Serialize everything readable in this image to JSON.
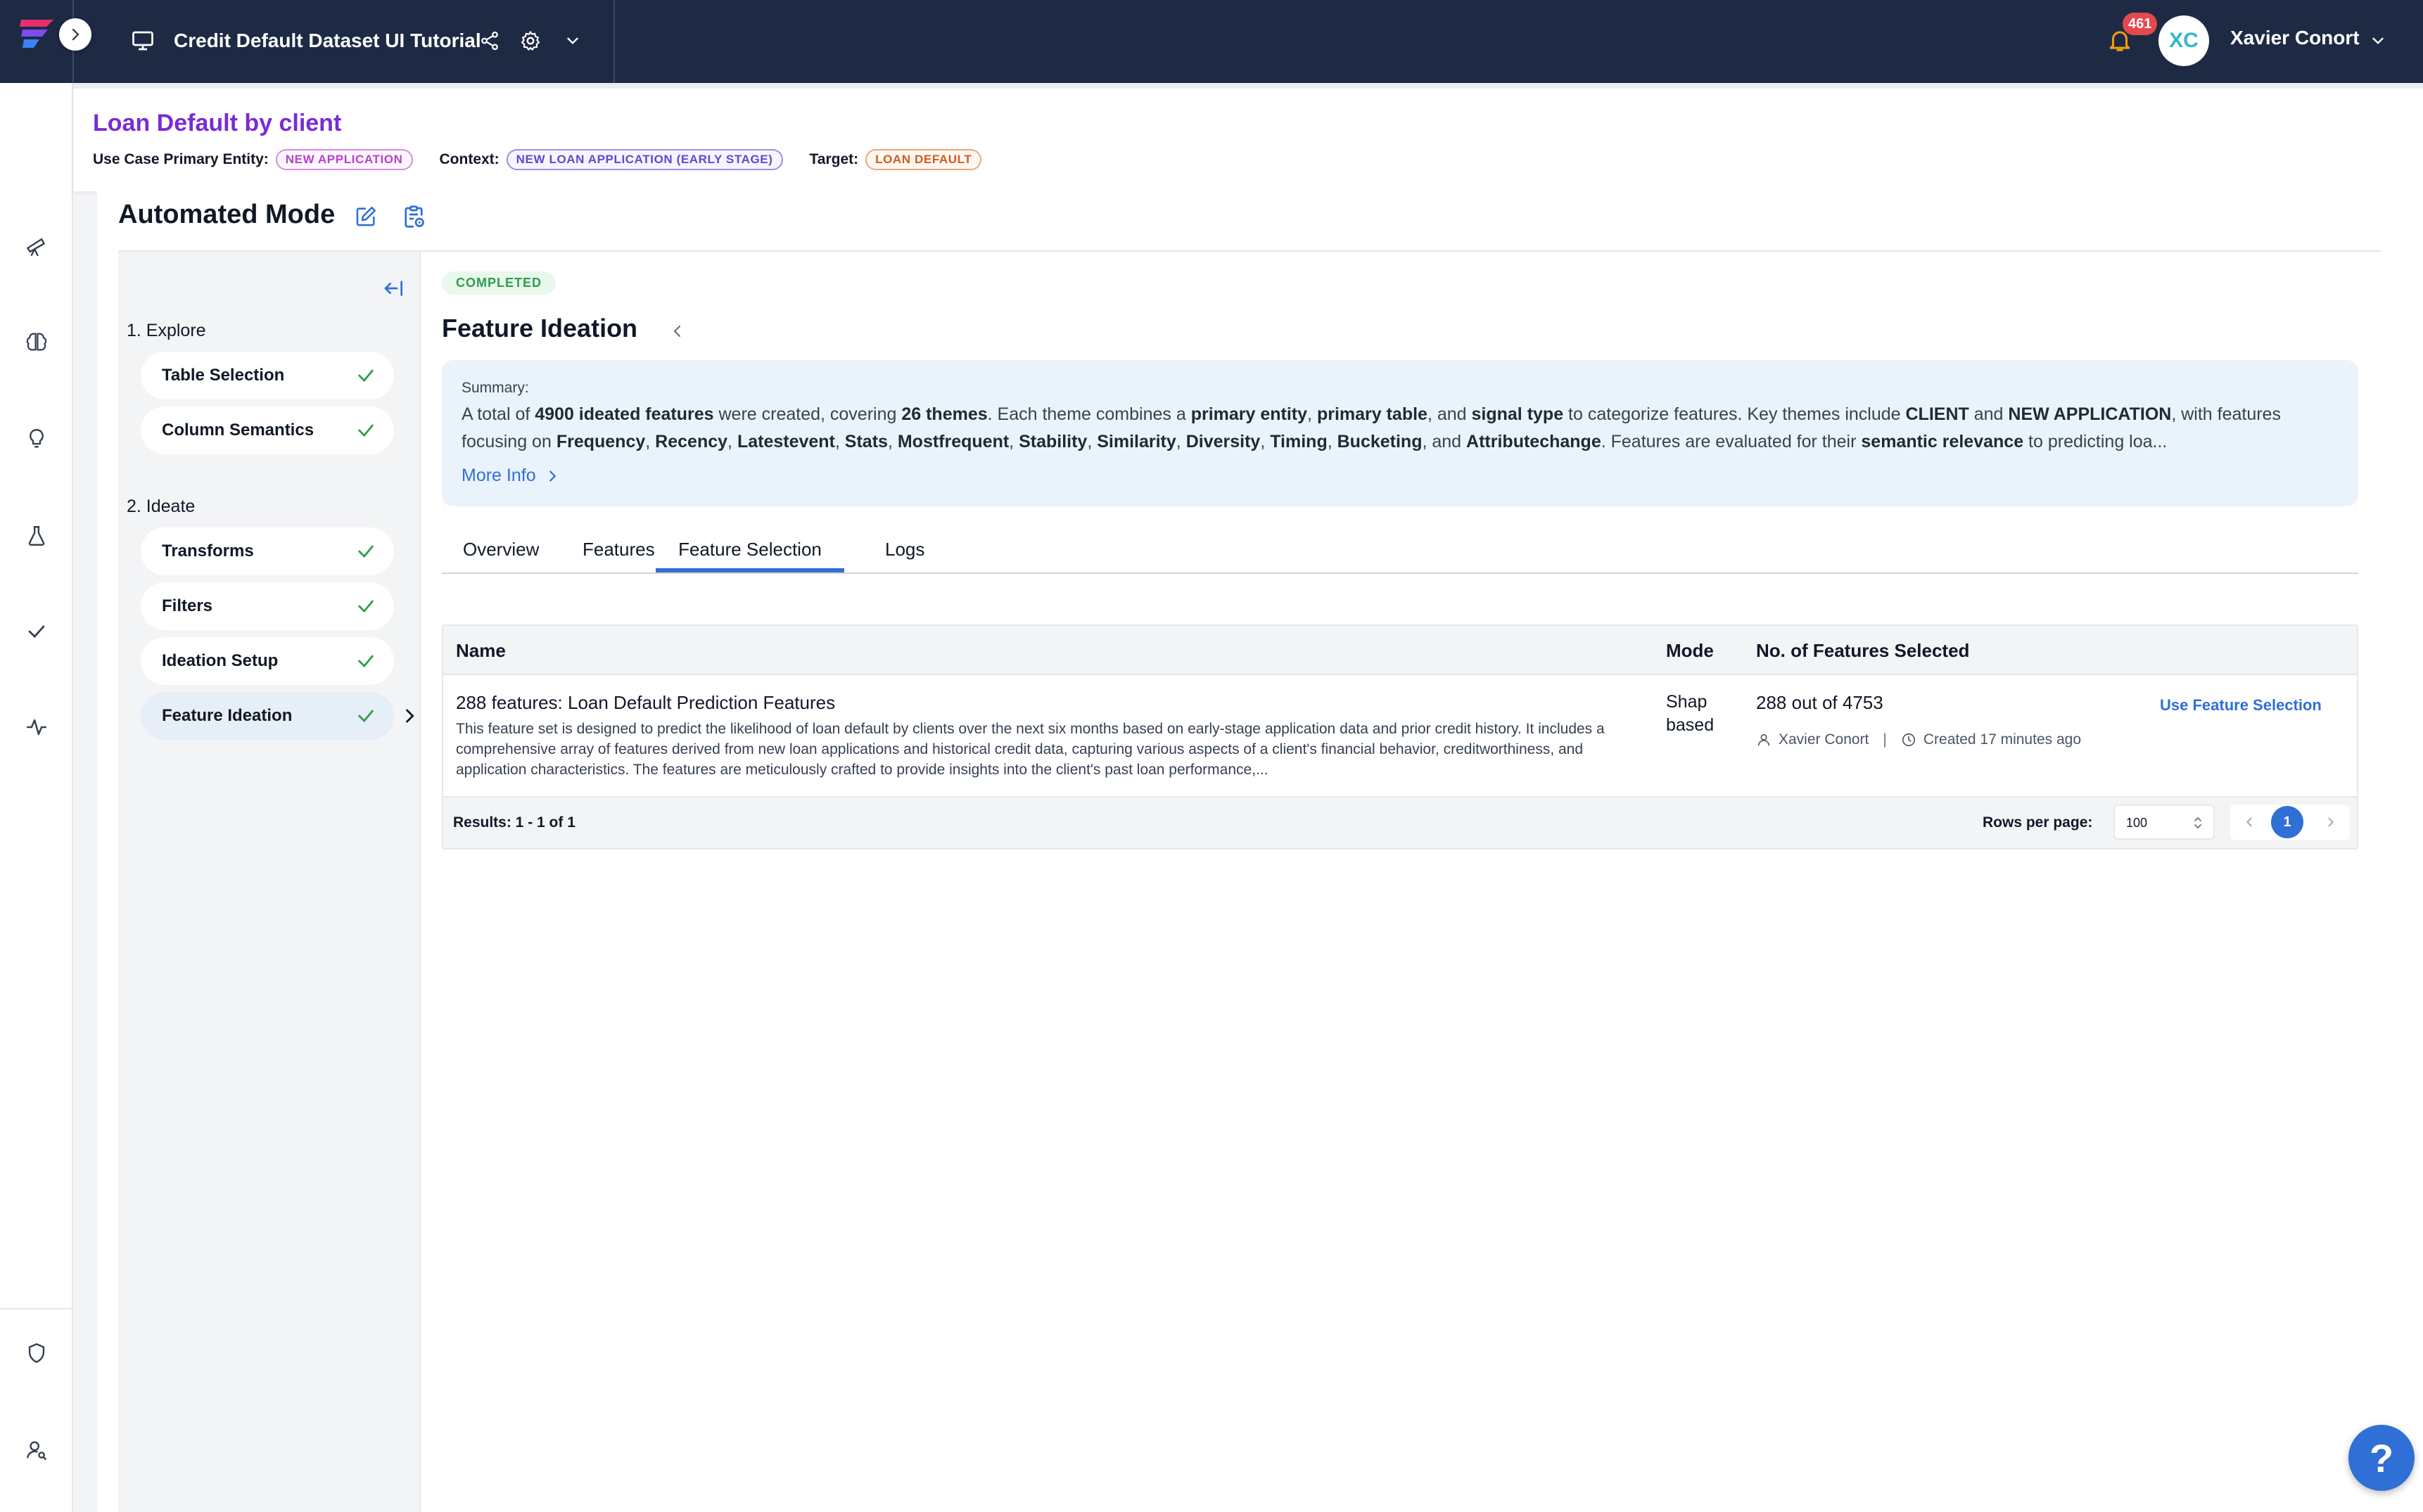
{
  "topbar": {
    "project_title": "Credit Default Dataset UI Tutorial",
    "notification_count": "461",
    "user_initials": "XC",
    "user_name": "Xavier Conort"
  },
  "usecase": {
    "title": "Loan Default by client",
    "primary_entity_label": "Use Case Primary Entity:",
    "primary_entity_value": "NEW APPLICATION",
    "context_label": "Context:",
    "context_value": "NEW LOAN APPLICATION (EARLY STAGE)",
    "target_label": "Target:",
    "target_value": "LOAN DEFAULT"
  },
  "mode": {
    "title": "Automated Mode"
  },
  "steps": {
    "explore_heading": "1. Explore",
    "explore_items": [
      "Table Selection",
      "Column Semantics"
    ],
    "ideate_heading": "2. Ideate",
    "ideate_items": [
      "Transforms",
      "Filters",
      "Ideation Setup",
      "Feature Ideation"
    ]
  },
  "content": {
    "status": "COMPLETED",
    "title": "Feature Ideation",
    "summary_label": "Summary:",
    "summary_parts": {
      "p1": "A total of ",
      "b1": "4900 ideated features",
      "p2": " were created, covering ",
      "b2": "26 themes",
      "p3": ". Each theme combines a ",
      "b3": "primary entity",
      "p4": ", ",
      "b4": "primary table",
      "p5": ", and ",
      "b5": "signal type",
      "p6": " to categorize features. Key themes include ",
      "b6": "CLIENT",
      "p7": " and ",
      "b7": "NEW APPLICATION",
      "p8": ", with features focusing on ",
      "b8": "Frequency",
      "p9": ", ",
      "b9": "Recency",
      "p10": ", ",
      "b10": "Latestevent",
      "p11": ", ",
      "b11": "Stats",
      "p12": ", ",
      "b12": "Mostfrequent",
      "p13": ", ",
      "b13": "Stability",
      "p14": ", ",
      "b14": "Similarity",
      "p15": ", ",
      "b15": "Diversity",
      "p16": ", ",
      "b16": "Timing",
      "p17": ", ",
      "b17": "Bucketing",
      "p18": ", and ",
      "b18": "Attributechange",
      "p19": ". Features are evaluated for their ",
      "b19": "semantic relevance",
      "p20": " to predicting loa..."
    },
    "more_info": "More Info",
    "tabs": [
      "Overview",
      "Features",
      "Feature Selection",
      "Logs"
    ],
    "active_tab": "Feature Selection"
  },
  "table": {
    "headers": {
      "name": "Name",
      "mode": "Mode",
      "count": "No. of Features Selected"
    },
    "rows": [
      {
        "name": "288 features: Loan Default Prediction Features",
        "description": "This feature set is designed to predict the likelihood of loan default by clients over the next six months based on early-stage application data and prior credit history. It includes a comprehensive array of features derived from new loan applications and historical credit data, capturing various aspects of a client's financial behavior, creditworthiness, and application characteristics. The features are meticulously crafted to provide insights into the client's past loan performance,...",
        "mode": "Shap based",
        "count": "288 out of 4753",
        "author": "Xavier Conort",
        "separator": "|",
        "created": "Created 17 minutes ago",
        "action": "Use Feature Selection"
      }
    ],
    "results": "Results: 1 - 1 of 1",
    "rows_per_page_label": "Rows per page:",
    "rows_per_page_value": "100",
    "current_page": "1"
  },
  "help": {
    "label": "?"
  },
  "colors": {
    "topbar_bg": "#1e2a44",
    "accent_blue": "#2f6fd6",
    "title_purple": "#7b2bd6",
    "success_green": "#2f9d4e",
    "badge_red": "#e5484d"
  }
}
